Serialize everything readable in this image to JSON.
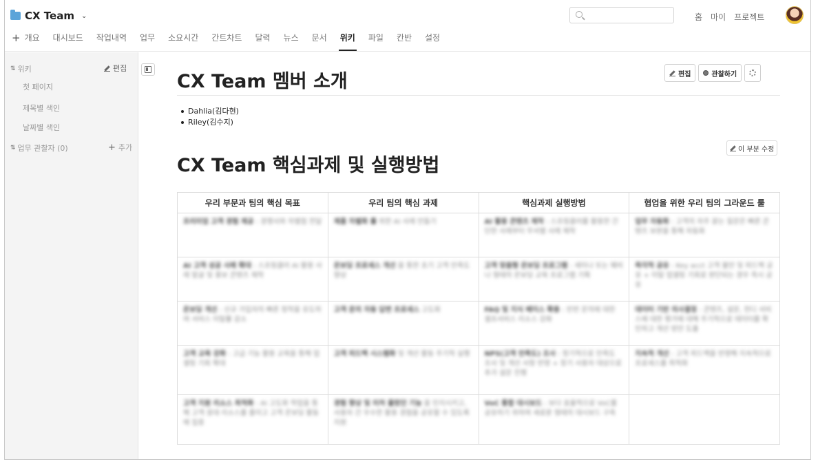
{
  "header": {
    "project_name": "CX Team",
    "top_links": [
      "홈",
      "마이",
      "프로젝트"
    ],
    "tabs": [
      {
        "label": "개요",
        "active": false
      },
      {
        "label": "대시보드",
        "active": false
      },
      {
        "label": "작업내역",
        "active": false
      },
      {
        "label": "업무",
        "active": false
      },
      {
        "label": "소요시간",
        "active": false
      },
      {
        "label": "간트차트",
        "active": false
      },
      {
        "label": "달력",
        "active": false
      },
      {
        "label": "뉴스",
        "active": false
      },
      {
        "label": "문서",
        "active": false
      },
      {
        "label": "위키",
        "active": true
      },
      {
        "label": "파일",
        "active": false
      },
      {
        "label": "칸반",
        "active": false
      },
      {
        "label": "설정",
        "active": false
      }
    ]
  },
  "sidebar": {
    "wiki_label": "위키",
    "edit_label": "편집",
    "items": [
      "첫 페이지",
      "제목별 색인",
      "날짜별 색인"
    ],
    "watchers_label": "업무 관찰자 (0)",
    "add_label": "추가"
  },
  "main": {
    "page_title": "CX Team 멤버 소개",
    "edit_label": "편집",
    "watch_label": "관찰하기",
    "members": [
      "Dahlia(김다현)",
      "Riley(김수지)"
    ],
    "section_edit_label": "이 부분 수정",
    "section_title": "CX Team 핵심과제 및 실행방법",
    "table": {
      "headers": [
        "우리 부문과 팀의 핵심 목표",
        "우리 팀의 핵심 과제",
        "핵심과제 실행방법",
        "협업을 위한 우리 팀의 그라운드 룰"
      ],
      "rows": [
        [
          {
            "b": "프리미엄 고객 경험 제공",
            "t": " : 경쟁사와 차별점 전달"
          },
          {
            "b": "제품 차별화 를",
            "t": " 위한 AI 사례 만들기"
          },
          {
            "b": "AI 활용 콘텐츠 제작",
            "t": " : 스프링클러를 활용한 간단한 사례부터 무서별 사례 제작"
          },
          {
            "b": "업무 자동화",
            "t": " : 고객의 자주 묻는 질문은 빠른 콘텐츠 보완을 통해 자동화"
          }
        ],
        [
          {
            "b": "AI 고객 성공 사례 확대",
            "t": " : 스프링클러 AI 활용 사례 발굴 및 홍보 콘텐츠 제작"
          },
          {
            "b": "온보딩 프로세스 개선",
            "t": " 을 통한 초기 고객 만족도 향상"
          },
          {
            "b": "고객 맞춤형 온보딩 프로그램",
            "t": " : 세미나 또는 웨비나 형태의 온보딩 교육 프로그램 기획"
          },
          {
            "b": "즉각적 공유",
            "t": " : Key acct 고객 불만 및 피드백 공유 + 이탈 업셀링 기회로 판단되는 경우 즉시 공유"
          }
        ],
        [
          {
            "b": "온보딩 개선",
            "t": " : 신규 가입자의 빠른 정착을 유도하여 서비스 이탈률 감소"
          },
          {
            "b": "고객 문의 자동 답변 프로세스",
            "t": " 고도화"
          },
          {
            "b": "FAQ 및 지식 베이스 확충",
            "t": " : 빈번 문의에 대한 셀프서비스 리소스 강화"
          },
          {
            "b": "데이터 기반 의사결정",
            "t": " : 콘텐츠, 설문, 헌디 서비스에 대한 평가에 대해 주기적으로 데이터를 확인하고 개선 방안 도출"
          }
        ],
        [
          {
            "b": "고객 교육 강화",
            "t": " : 고급 기능 활용 교육을 통해 업셀링 기회 확대"
          },
          {
            "b": "고객 피드백 시스템화",
            "t": " 및 개선 활동 주기적 실행"
          },
          {
            "b": "NPS(고객 만족도) 조사",
            "t": " : 정기적으로 만족도 조사 및 개선 사항 반영 + 장기 사용자 대상으로 추가 설문 진행"
          },
          {
            "b": "지속적 개선",
            "t": " : 고객 피드백을 반영해 지속적으로 프로세스를 최적화"
          }
        ],
        [
          {
            "b": "고객 지원 리소스 최적화",
            "t": " : AI 고도화 작업을 통해 고객 응대 리소스를 줄이고 고객 온보딩 활동에 집중"
          },
          {
            "b": "경험 향상 및 미처 몰랐던 기능",
            "t": " 을 인지시키고, 사용자 간 우수한 활용 경험을 공유할 수 있도록 지원"
          },
          {
            "b": "VoC 통합 대시보드",
            "t": " : 보다 효율적으로 VoC를 공유하기 위하여 새로운 형태의 대시보드 구축"
          },
          {
            "b": "",
            "t": ""
          }
        ]
      ]
    }
  }
}
